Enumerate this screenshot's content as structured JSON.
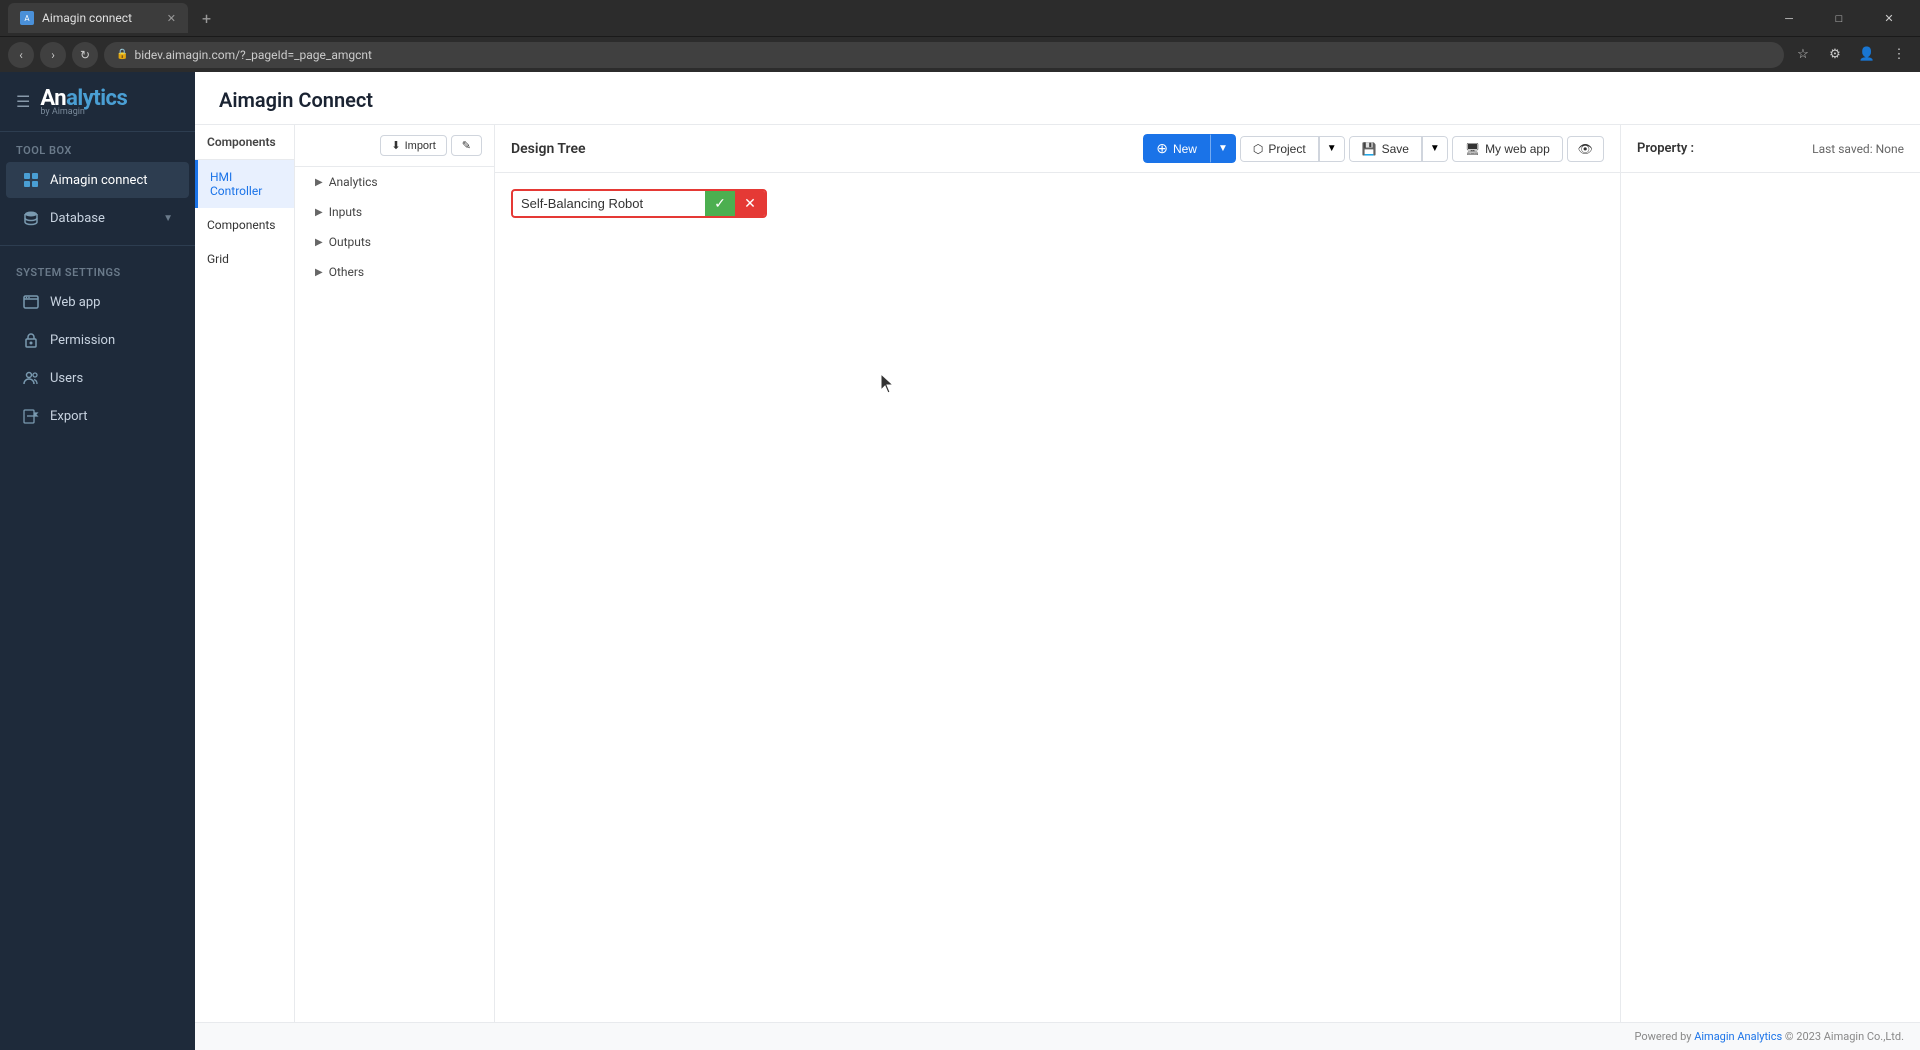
{
  "browser": {
    "tab_title": "Aimagin connect",
    "url": "bidev.aimagin.com/?_pageId=_page_amgcnt",
    "new_tab_label": "+"
  },
  "app": {
    "brand": "Analytics",
    "brand_sub": "by Aimagin",
    "page_title": "Aimagin Connect"
  },
  "sidebar": {
    "toolbox_label": "Tool box",
    "system_settings_label": "System settings",
    "items": [
      {
        "id": "aimagin-connect",
        "label": "Aimagin connect",
        "active": true
      },
      {
        "id": "database",
        "label": "Database",
        "has_chevron": true
      },
      {
        "id": "web-app",
        "label": "Web app"
      },
      {
        "id": "permission",
        "label": "Permission"
      },
      {
        "id": "users",
        "label": "Users"
      },
      {
        "id": "export",
        "label": "Export"
      }
    ]
  },
  "components_panel": {
    "header": "Components",
    "items": [
      {
        "id": "hmi-controller",
        "label": "HMI Controller",
        "active": true
      },
      {
        "id": "components",
        "label": "Components"
      },
      {
        "id": "grid",
        "label": "Grid"
      }
    ]
  },
  "tree_panel": {
    "import_btn": "Import",
    "edit_btn": "✎",
    "items": [
      {
        "id": "analytics",
        "label": "Analytics"
      },
      {
        "id": "inputs",
        "label": "Inputs"
      },
      {
        "id": "outputs",
        "label": "Outputs"
      },
      {
        "id": "others",
        "label": "Others"
      }
    ]
  },
  "design_tree": {
    "title": "Design Tree",
    "new_btn": "New",
    "project_btn": "Project",
    "save_btn": "Save",
    "my_web_app_btn": "My web app",
    "preview_btn": "👁",
    "name_input_value": "Self-Balancing Robot",
    "confirm_icon": "✓",
    "cancel_icon": "✕"
  },
  "property": {
    "header": "Property :",
    "last_saved_label": "Last saved:",
    "last_saved_value": "None"
  },
  "footer": {
    "powered_by": "Powered by",
    "company": "Aimagin Analytics",
    "copyright": "© 2023 Aimagin Co.,Ltd."
  }
}
